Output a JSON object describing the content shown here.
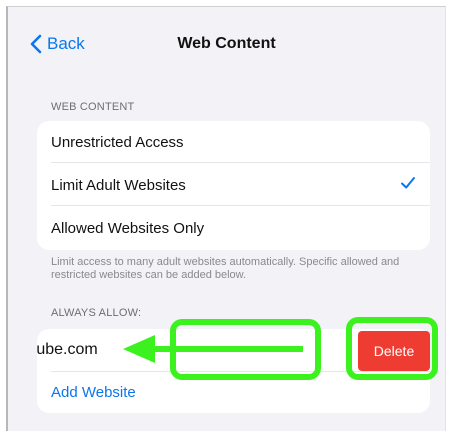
{
  "nav": {
    "back_label": "Back",
    "title": "Web Content"
  },
  "web_content": {
    "header": "WEB CONTENT",
    "options": [
      {
        "label": "Unrestricted Access",
        "selected": false
      },
      {
        "label": "Limit Adult Websites",
        "selected": true
      },
      {
        "label": "Allowed Websites Only",
        "selected": false
      }
    ],
    "footer": "Limit access to many adult websites automatically. Specific allowed and restricted websites can be added below."
  },
  "always_allow": {
    "header": "ALWAYS ALLOW:",
    "site": "utube.com",
    "delete_label": "Delete",
    "add_label": "Add Website"
  },
  "colors": {
    "accent": "#0a76f0",
    "delete": "#ef3c32",
    "annotation": "#3cf21e"
  },
  "icons": {
    "back": "chevron-left-icon",
    "check": "checkmark-icon",
    "annotation": "swipe-left-arrow-icon"
  }
}
